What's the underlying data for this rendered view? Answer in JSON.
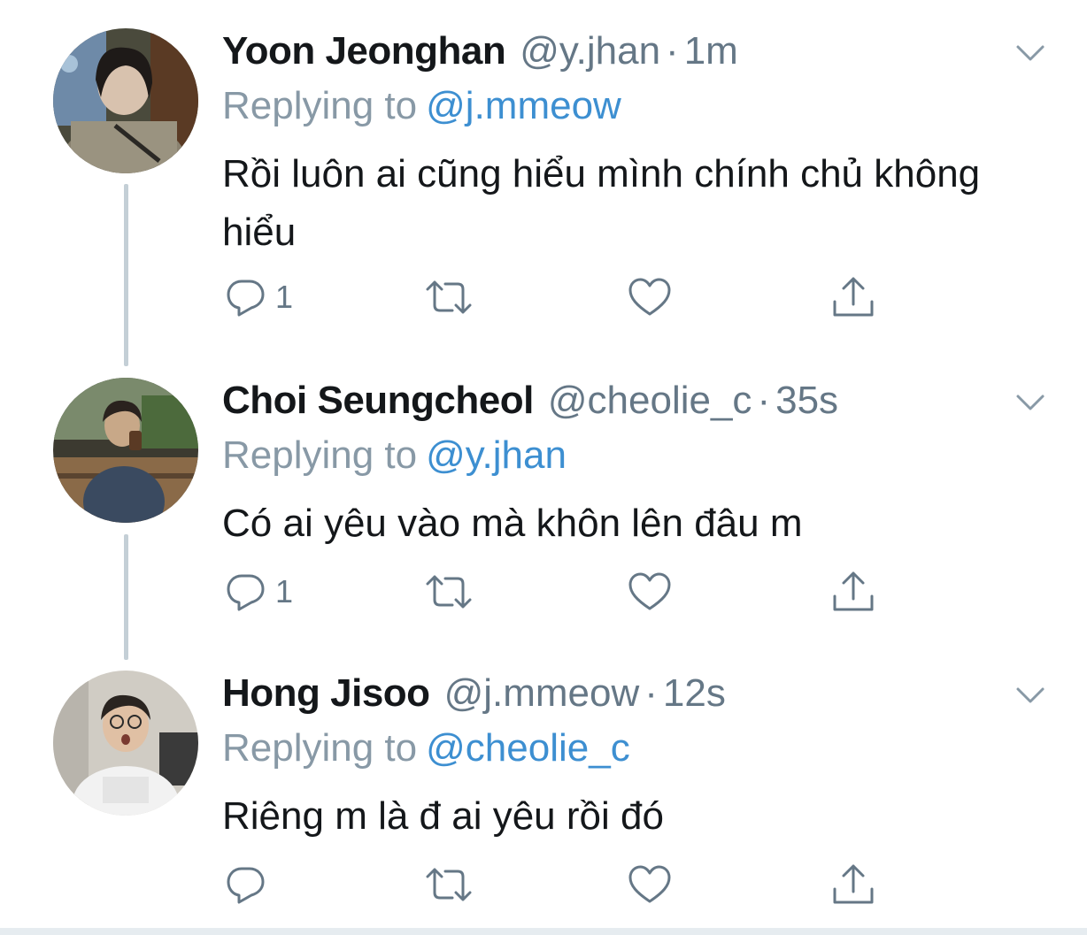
{
  "tweets": [
    {
      "name": "Yoon Jeonghan",
      "handle": "@y.jhan",
      "time": "1m",
      "replying_label": "Replying to",
      "replying_to": "@j.mmeow",
      "text": "Rồi luôn ai cũng hiểu mình chính chủ không hiểu",
      "reply_count": "1"
    },
    {
      "name": "Choi Seungcheol",
      "handle": "@cheolie_c",
      "time": "35s",
      "replying_label": "Replying to",
      "replying_to": "@y.jhan",
      "text": "Có ai yêu vào mà khôn lên đâu m",
      "reply_count": "1"
    },
    {
      "name": "Hong Jisoo",
      "handle": "@j.mmeow",
      "time": "12s",
      "replying_label": "Replying to",
      "replying_to": "@cheolie_c",
      "text": "Riêng m là đ ai yêu rồi đó",
      "reply_count": ""
    }
  ],
  "separator": "·",
  "icons": {
    "reply": "reply-icon",
    "retweet": "retweet-icon",
    "like": "heart-icon",
    "share": "share-icon",
    "more": "chevron-down-icon"
  },
  "colors": {
    "text": "#14171a",
    "muted": "#657786",
    "link": "#3d8fd1",
    "thread_line": "#c4cfd6"
  }
}
